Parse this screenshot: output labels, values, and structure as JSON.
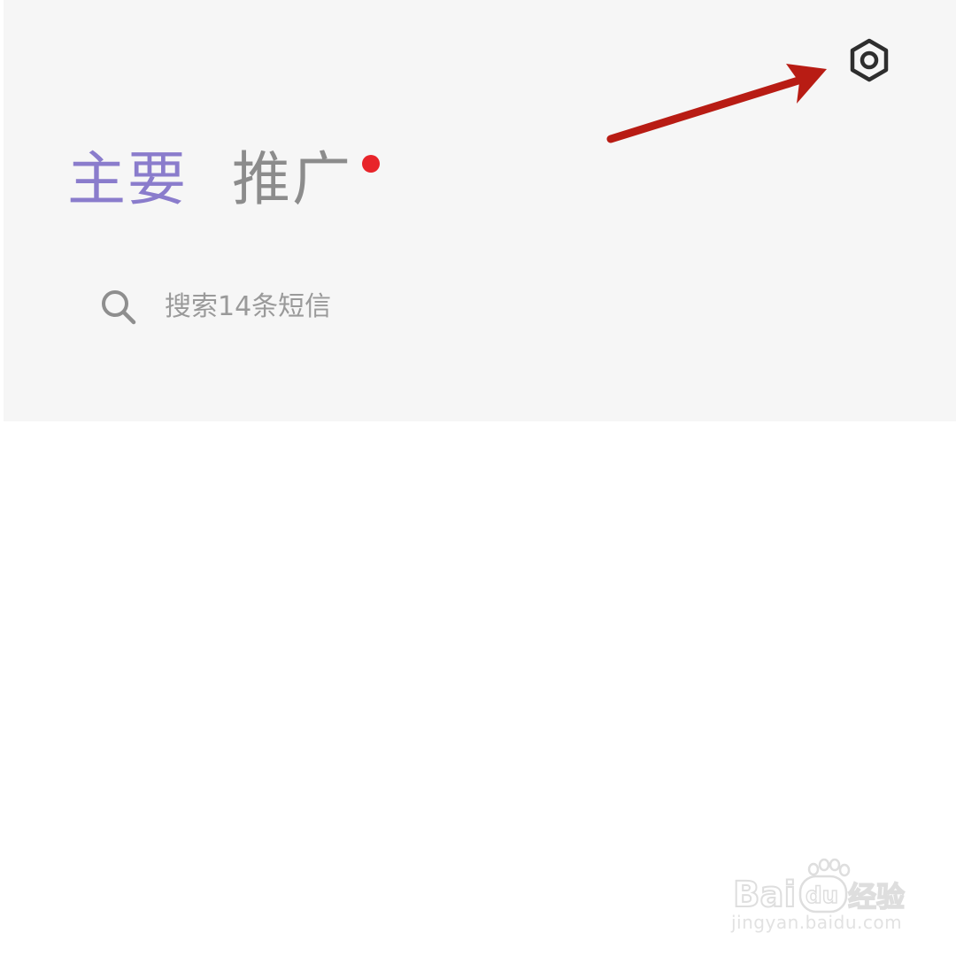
{
  "colors": {
    "header_background": "#f6f6f6",
    "page_background": "#ffffff",
    "active_tab": "#8a7ccc",
    "inactive_tab": "#8c8c8c",
    "badge": "#e8242a",
    "annotation_arrow": "#b81c14",
    "watermark": "#e2e2e2"
  },
  "header": {
    "settings_icon": "gear-icon",
    "tabs": [
      {
        "label": "主要",
        "active": true
      },
      {
        "label": "推广",
        "active": false,
        "has_badge": true
      }
    ]
  },
  "search": {
    "icon": "search-icon",
    "placeholder": "搜索14条短信"
  },
  "watermark": {
    "logo_text": "Bai du 经验",
    "url": "jingyan.baidu.com"
  }
}
